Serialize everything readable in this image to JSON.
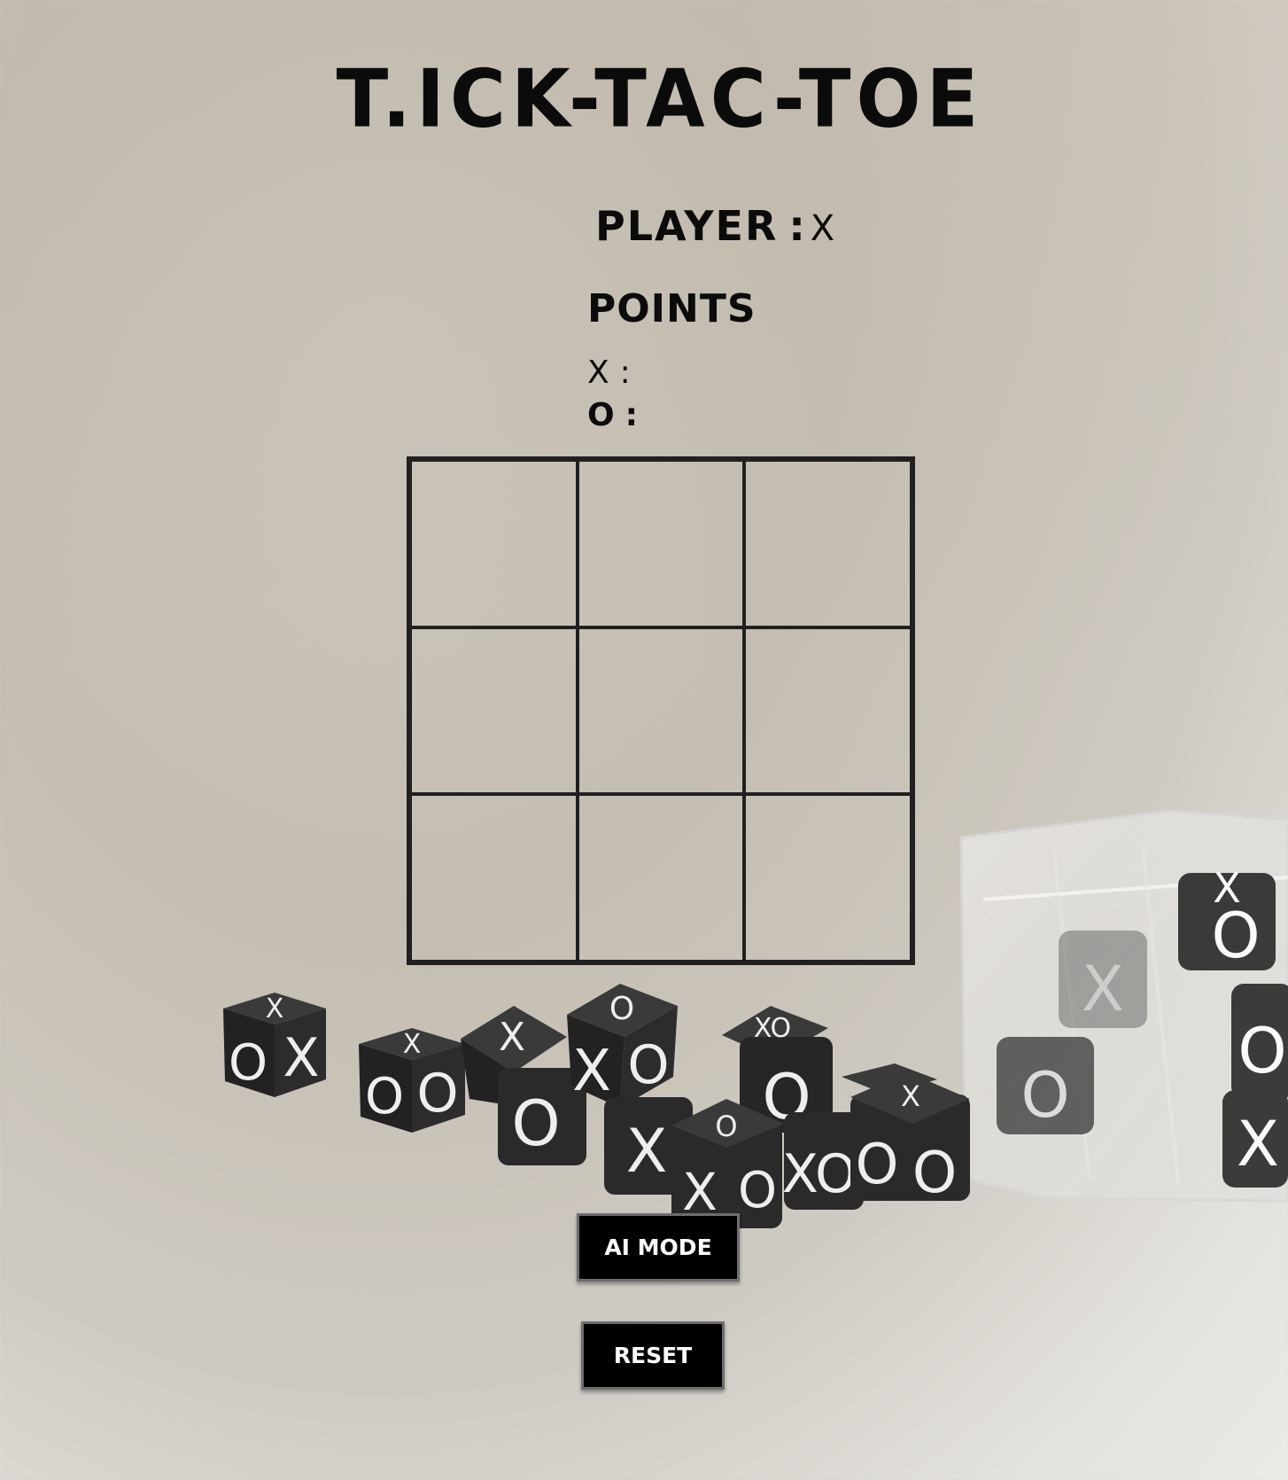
{
  "title": "T.ICK-TAC-TOE",
  "status": {
    "player_label": "PLAYER",
    "separator": ":",
    "current_player": "X"
  },
  "points": {
    "title": "POINTS",
    "x_label": "X",
    "o_label": "O",
    "separator": ":",
    "x_value": "",
    "o_value": ""
  },
  "board": {
    "cells": [
      "",
      "",
      "",
      "",
      "",
      "",
      "",
      "",
      ""
    ]
  },
  "buttons": {
    "ai_mode": "AI MODE",
    "reset": "RESET"
  },
  "background": {
    "image": "black-dice-with-x-and-o-glyphs-and-clear-box"
  }
}
